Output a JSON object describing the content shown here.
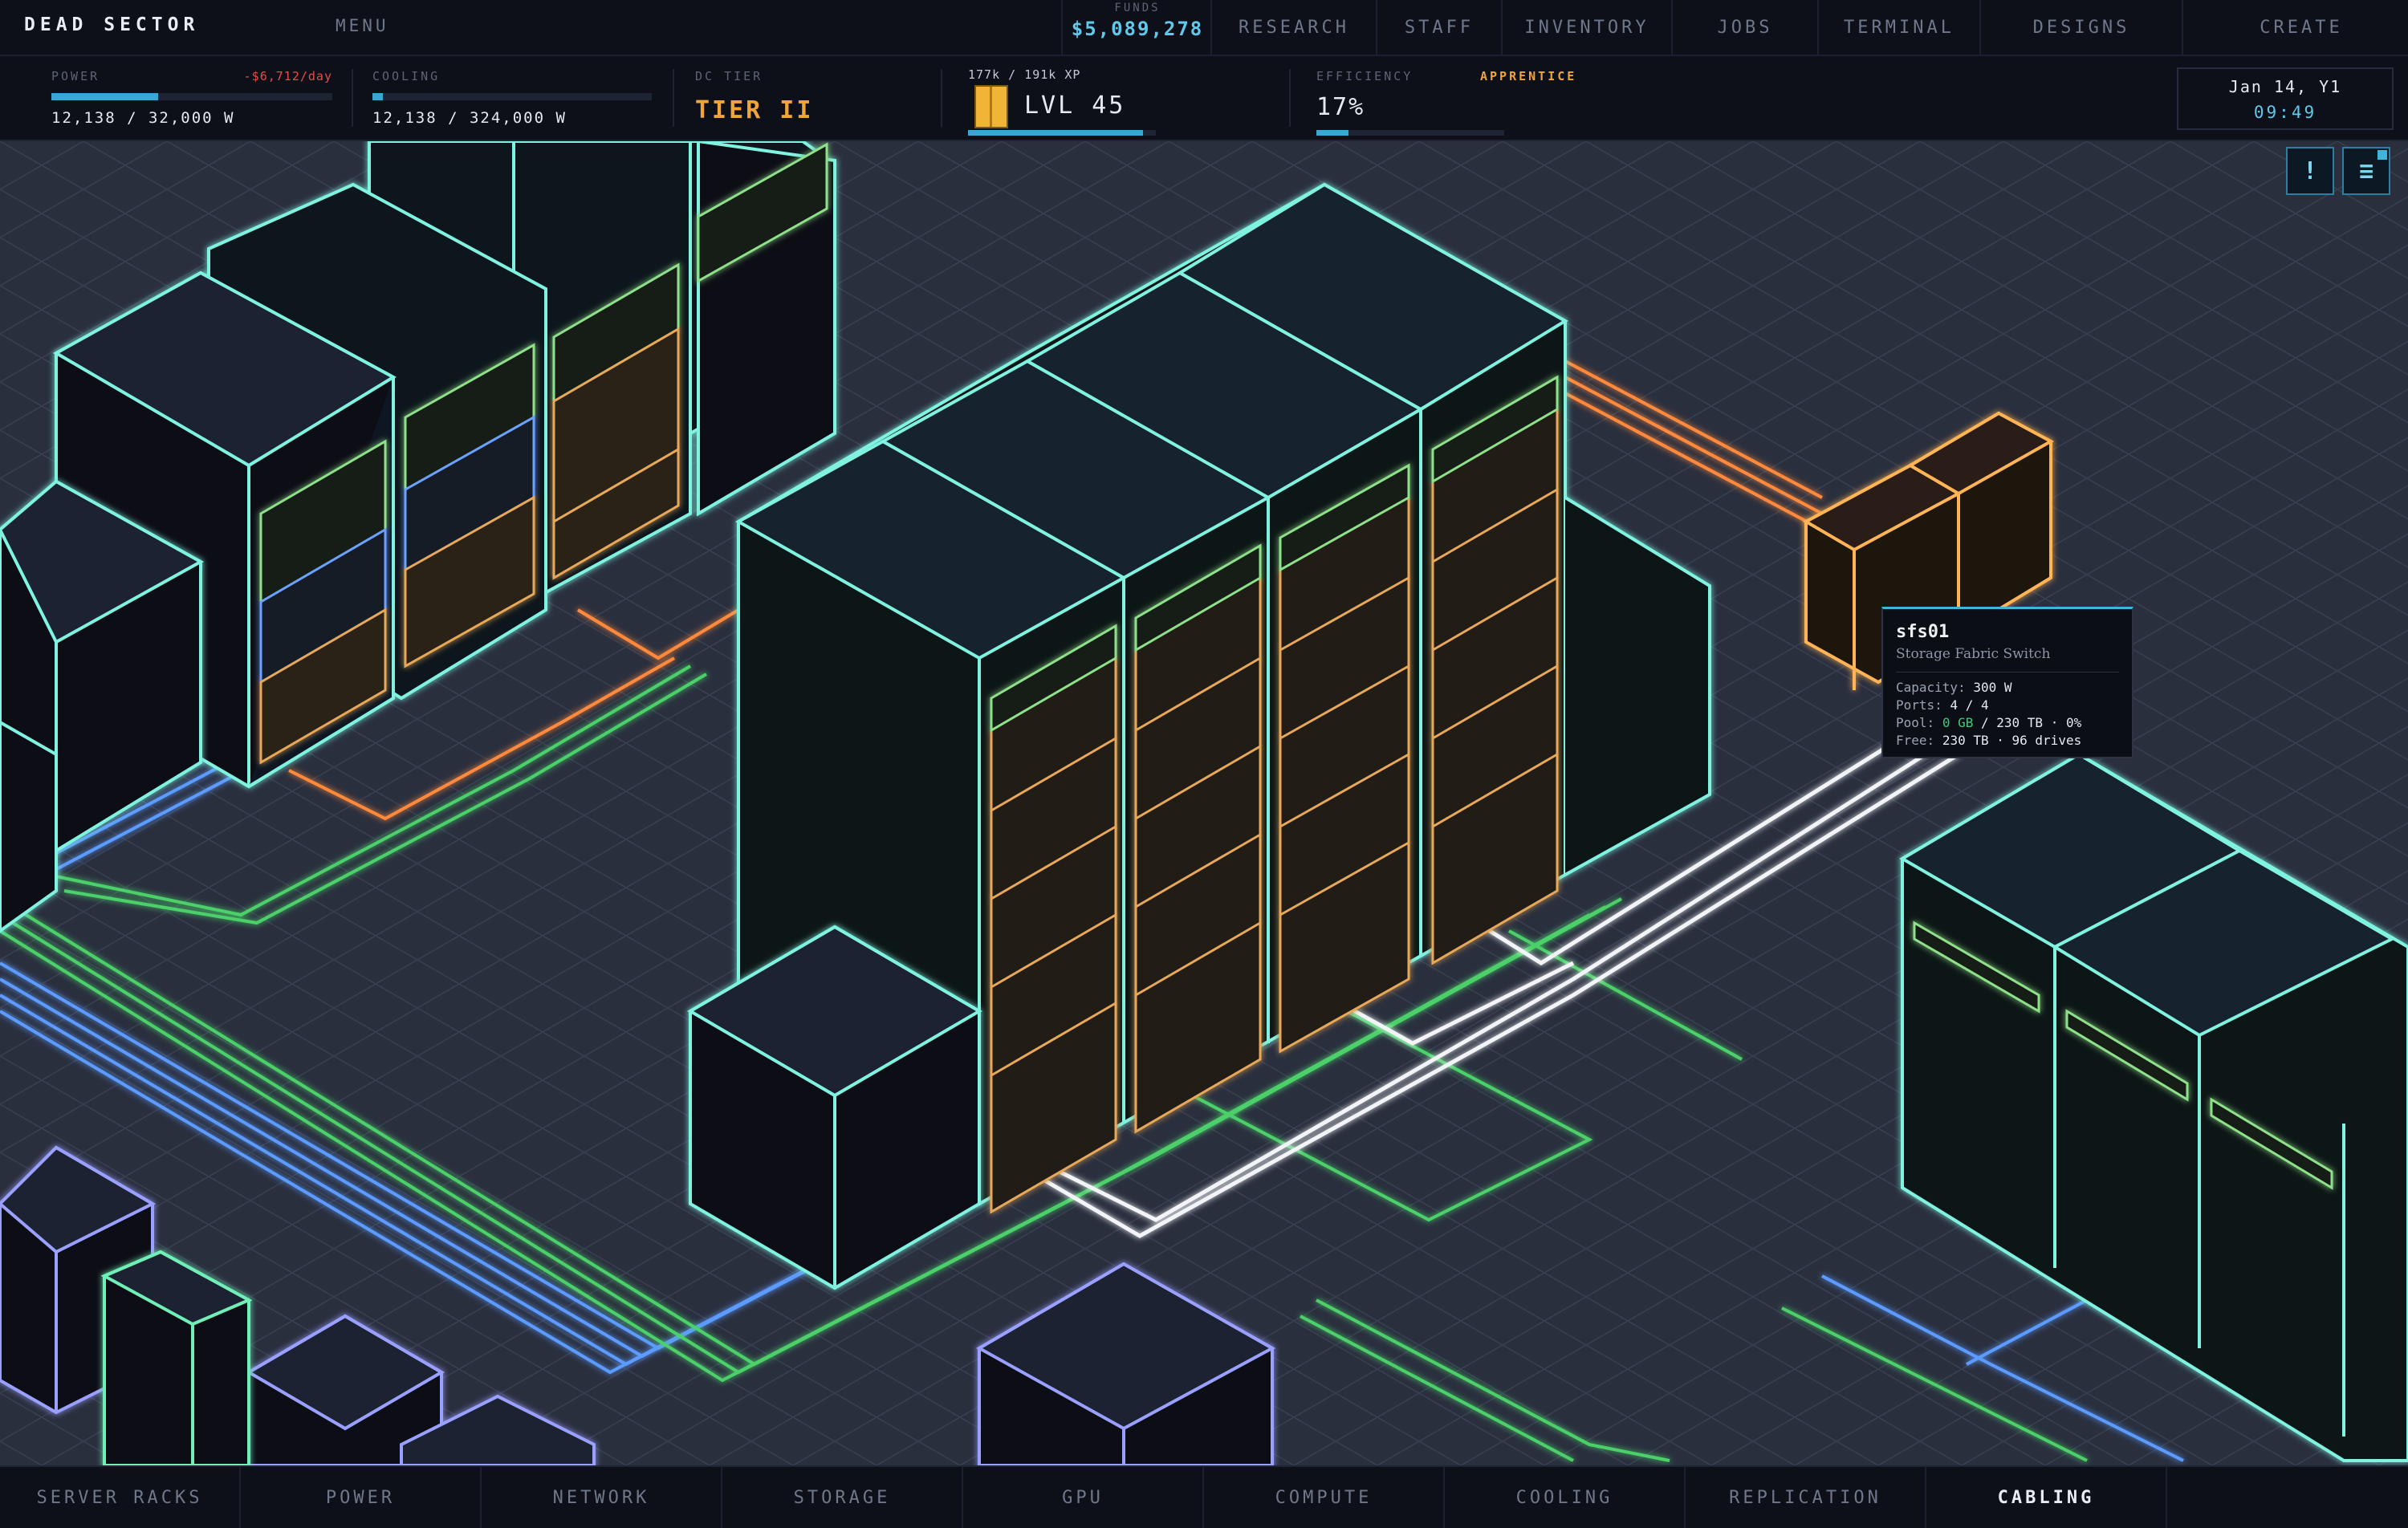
{
  "header": {
    "brand": "DEAD SECTOR",
    "menu": "MENU",
    "funds_label": "FUNDS",
    "funds_value": "$5,089,278",
    "tabs": [
      "RESEARCH",
      "STAFF",
      "INVENTORY",
      "JOBS",
      "TERMINAL",
      "DESIGNS",
      "CREATE"
    ]
  },
  "stats": {
    "power": {
      "label": "POWER",
      "delta": "-$6,712/day",
      "value": "12,138 / 32,000 W",
      "fraction": 0.38
    },
    "cooling": {
      "label": "COOLING",
      "value": "12,138 / 324,000 W",
      "fraction": 0.037
    },
    "tier": {
      "label": "DC TIER",
      "value": "TIER II"
    },
    "xp": {
      "label": "177k / 191k XP",
      "level": "LVL 45",
      "fraction": 0.93
    },
    "efficiency": {
      "label": "EFFICIENCY",
      "rank": "APPRENTICE",
      "value": "17%",
      "fraction": 0.17
    }
  },
  "clock": {
    "date": "Jan 14, Y1",
    "time": "09:49"
  },
  "buttons": {
    "alert": "!",
    "menu": "≡"
  },
  "tooltip": {
    "name": "sfs01",
    "type": "Storage Fabric Switch",
    "capacity_label": "Capacity:",
    "capacity_value": "300 W",
    "ports_label": "Ports:",
    "ports_value": "4 / 4",
    "pool_label": "Pool:",
    "pool_used": "0 GB",
    "pool_total": "/ 230 TB",
    "pool_pct": "·  0%",
    "free_label": "Free:",
    "free_value": "230 TB",
    "free_drives": "·  96 drives"
  },
  "bottom_tabs": [
    "SERVER RACKS",
    "POWER",
    "NETWORK",
    "STORAGE",
    "GPU",
    "COMPUTE",
    "COOLING",
    "REPLICATION",
    "CABLING"
  ],
  "active_bottom_tab": "CABLING",
  "colors": {
    "rack_outline": "#7ff2e0",
    "storage_outline": "#ffb454",
    "network_cable": "#5b9bff",
    "power_cable": "#4cd06a",
    "fabric_cable": "#ff8a3c",
    "accent": "#3fb6d9"
  }
}
